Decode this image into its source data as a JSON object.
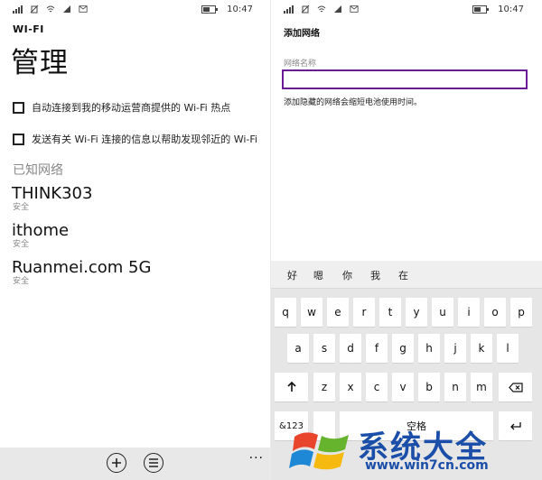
{
  "left": {
    "status": {
      "time": "10:47"
    },
    "app_title": "WI-FI",
    "page_title": "管理",
    "options": [
      {
        "label": "自动连接到我的移动运营商提供的 Wi-Fi 热点"
      },
      {
        "label": "发送有关 Wi-Fi 连接的信息以帮助发现邻近的 Wi-Fi"
      }
    ],
    "section_title": "已知网络",
    "networks": [
      {
        "name": "THINK303",
        "security": "安全"
      },
      {
        "name": "ithome",
        "security": "安全"
      },
      {
        "name": "Ruanmei.com 5G",
        "security": "安全"
      }
    ],
    "appbar": {
      "add_icon": "plus-circle-icon",
      "list_icon": "list-circle-icon",
      "more": "..."
    }
  },
  "right": {
    "status": {
      "time": "10:47"
    },
    "title": "添加网络",
    "field_label": "网络名称",
    "field_value": "",
    "hint": "添加隐藏的网络会缩短电池使用时间。",
    "keyboard": {
      "suggestions": [
        "好",
        "嗯",
        "你",
        "我",
        "在"
      ],
      "row1": [
        "q",
        "w",
        "e",
        "r",
        "t",
        "y",
        "u",
        "i",
        "o",
        "p"
      ],
      "row2": [
        "a",
        "s",
        "d",
        "f",
        "g",
        "h",
        "j",
        "k",
        "l"
      ],
      "row3": [
        "z",
        "x",
        "c",
        "v",
        "b",
        "n",
        "m"
      ],
      "shift_icon": "shift-up-arrow-icon",
      "backspace_icon": "backspace-icon",
      "symbols_label": "&123",
      "space_label": "空格"
    }
  },
  "watermark": {
    "text": "系统大全",
    "url": "www.win7cn.com"
  },
  "colors": {
    "accent": "#6a1b9a",
    "watermark_blue": "#1a4ea8"
  }
}
